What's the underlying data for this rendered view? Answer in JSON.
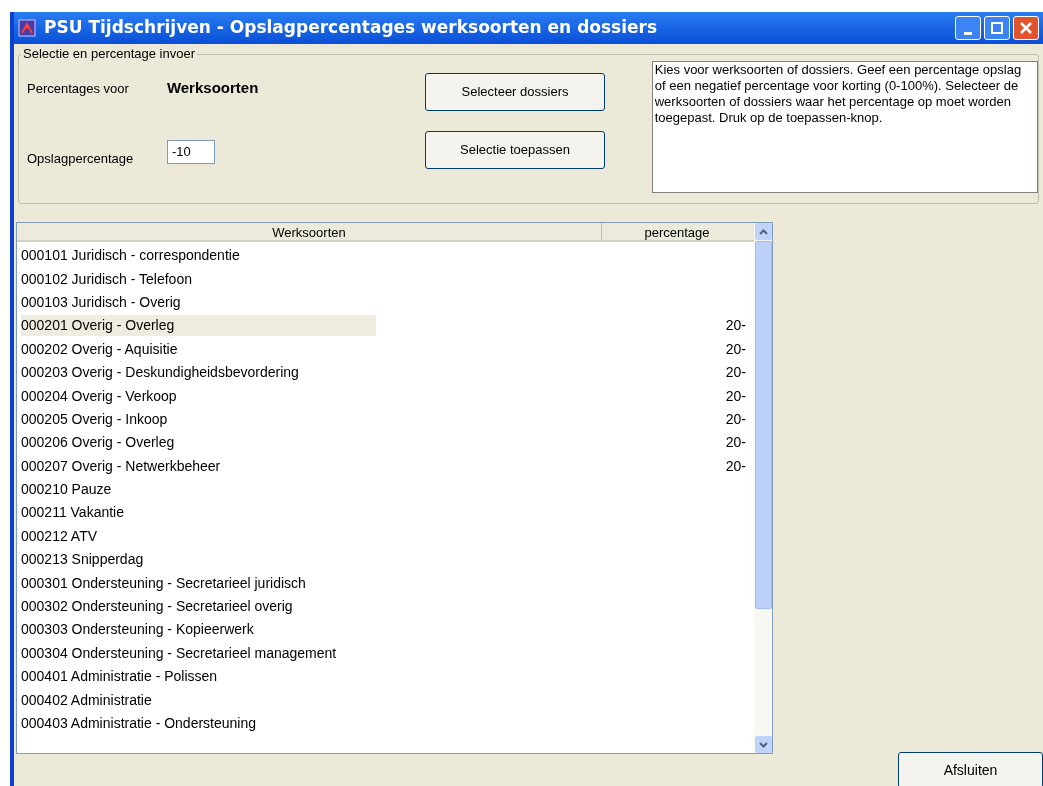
{
  "window": {
    "title": "PSU Tijdschrijven - Opslagpercentages werksoorten en dossiers"
  },
  "selection_group": {
    "legend": "Selectie en percentage invoer",
    "percentages_label": "Percentages voor",
    "percentages_value": "Werksoorten",
    "surcharge_label": "Opslagpercentage",
    "surcharge_value": "-10",
    "select_button": "Selecteer dossiers",
    "apply_button": "Selectie toepassen",
    "help_text": "Kies voor werksoorten of dossiers. Geef een percentage opslag of een negatief percentage voor korting (0-100%). Selecteer de werksoorten of dossiers waar het percentage op moet worden toegepast. Druk op de toepassen-knop."
  },
  "table": {
    "columns": [
      "Werksoorten",
      "percentage"
    ],
    "rows": [
      {
        "name": "000101 Juridisch - correspondentie",
        "selected": false
      },
      {
        "name": "000102 Juridisch - Telefoon",
        "selected": false
      },
      {
        "name": "000103 Juridisch - Overig",
        "selected": false
      },
      {
        "name": "000201 Overig - Overleg",
        "percentage": "20-",
        "selected": true
      },
      {
        "name": "000202 Overig - Aquisitie",
        "percentage": "20-",
        "selected": false
      },
      {
        "name": "000203 Overig - Deskundigheidsbevordering",
        "percentage": "20-",
        "selected": false
      },
      {
        "name": "000204 Overig - Verkoop",
        "percentage": "20-",
        "selected": false
      },
      {
        "name": "000205 Overig - Inkoop",
        "percentage": "20-",
        "selected": false
      },
      {
        "name": "000206 Overig - Overleg",
        "percentage": "20-",
        "selected": false
      },
      {
        "name": "000207 Overig - Netwerkbeheer",
        "percentage": "20-",
        "selected": false
      },
      {
        "name": "000210 Pauze",
        "selected": false
      },
      {
        "name": "000211 Vakantie",
        "selected": false
      },
      {
        "name": "000212 ATV",
        "selected": false
      },
      {
        "name": "000213 Snipperdag",
        "selected": false
      },
      {
        "name": "000301 Ondersteuning - Secretarieel juridisch",
        "selected": false
      },
      {
        "name": "000302 Ondersteuning - Secretarieel overig",
        "selected": false
      },
      {
        "name": "000303 Ondersteuning - Kopieerwerk",
        "selected": false
      },
      {
        "name": "000304 Ondersteuning - Secretarieel management",
        "selected": false
      },
      {
        "name": "000401 Administratie - Polissen",
        "selected": false
      },
      {
        "name": "000402 Administratie",
        "selected": false
      },
      {
        "name": "000403 Administratie - Ondersteuning",
        "selected": false
      }
    ]
  },
  "close_button": "Afsluiten"
}
